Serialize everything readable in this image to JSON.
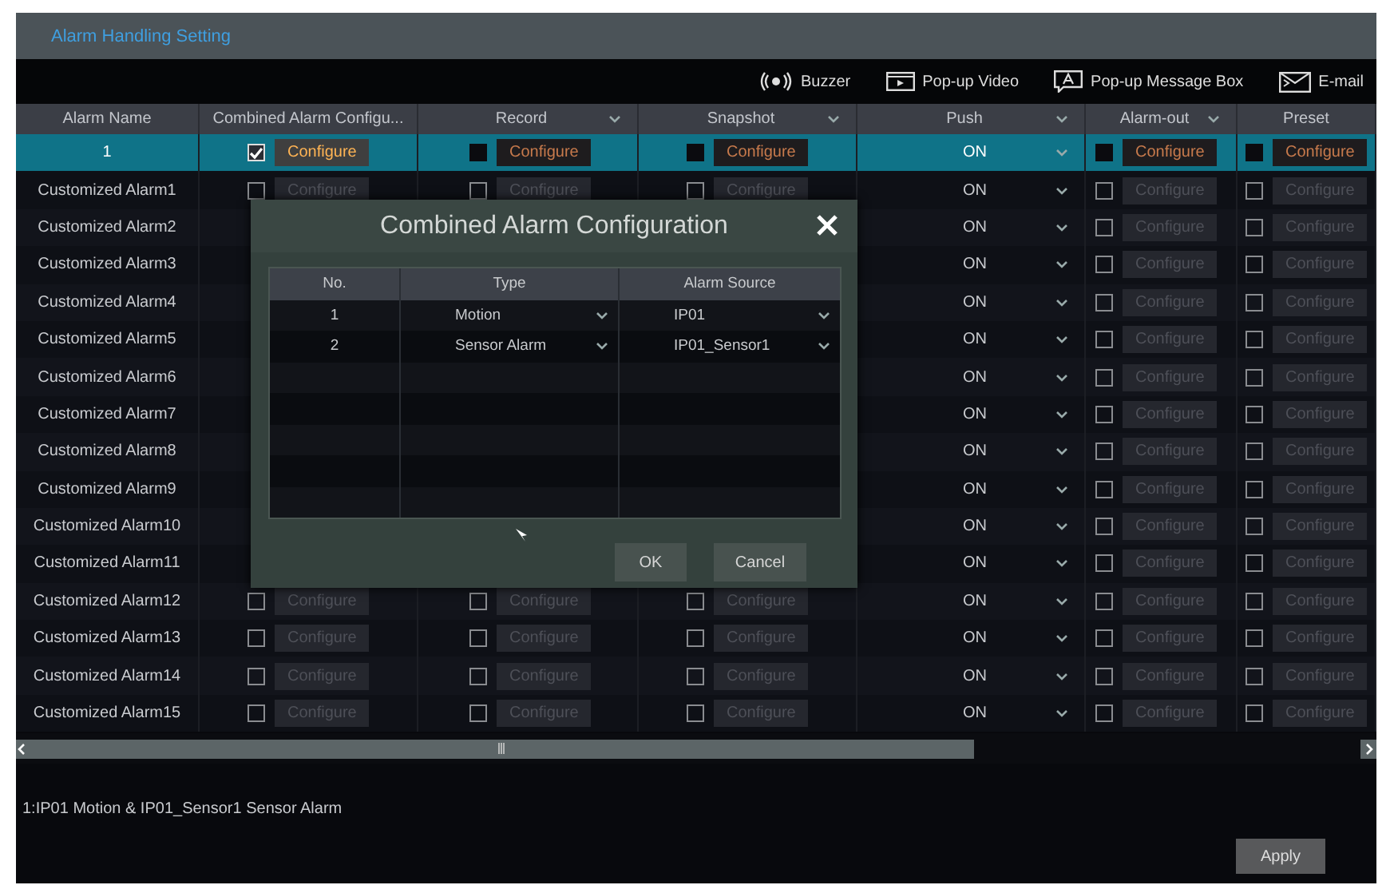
{
  "window": {
    "title": "Alarm Handling Setting"
  },
  "toolbar": [
    {
      "kind": "buzzer",
      "label": "Buzzer"
    },
    {
      "kind": "video",
      "label": "Pop-up Video"
    },
    {
      "kind": "message",
      "label": "Pop-up Message Box"
    },
    {
      "kind": "email",
      "label": "E-mail"
    }
  ],
  "table": {
    "columns": [
      {
        "label": "Alarm Name",
        "dropdown": false
      },
      {
        "label": "Combined Alarm Configu...",
        "dropdown": false
      },
      {
        "label": "Record",
        "dropdown": true
      },
      {
        "label": "Snapshot",
        "dropdown": true
      },
      {
        "label": "Push",
        "dropdown": true
      },
      {
        "label": "Alarm-out",
        "dropdown": true
      },
      {
        "label": "Preset",
        "dropdown": false
      }
    ],
    "rows": [
      {
        "name": "1",
        "selected": true,
        "combined": {
          "checked": true,
          "button": "Configure"
        },
        "record": {
          "checked": false,
          "button": "Configure"
        },
        "snapshot": {
          "checked": false,
          "button": "Configure"
        },
        "push": "ON",
        "alarm_out": {
          "checked": false,
          "button": "Configure"
        },
        "preset": {
          "checked": false,
          "button": "Configure"
        }
      },
      {
        "name": "Customized Alarm1",
        "selected": false,
        "combined": {
          "checked": false,
          "button": "Configure"
        },
        "record": {
          "checked": false,
          "button": "Configure"
        },
        "snapshot": {
          "checked": false,
          "button": "Configure"
        },
        "push": "ON",
        "alarm_out": {
          "checked": false,
          "button": "Configure"
        },
        "preset": {
          "checked": false,
          "button": "Configure"
        }
      },
      {
        "name": "Customized Alarm2",
        "selected": false,
        "push": "ON",
        "alarm_out": {
          "checked": false,
          "button": "Configure"
        },
        "preset": {
          "checked": false,
          "button": "Configure"
        }
      },
      {
        "name": "Customized Alarm3",
        "selected": false,
        "push": "ON",
        "alarm_out": {
          "checked": false,
          "button": "Configure"
        },
        "preset": {
          "checked": false,
          "button": "Configure"
        }
      },
      {
        "name": "Customized Alarm4",
        "selected": false,
        "push": "ON",
        "alarm_out": {
          "checked": false,
          "button": "Configure"
        },
        "preset": {
          "checked": false,
          "button": "Configure"
        }
      },
      {
        "name": "Customized Alarm5",
        "selected": false,
        "push": "ON",
        "alarm_out": {
          "checked": false,
          "button": "Configure"
        },
        "preset": {
          "checked": false,
          "button": "Configure"
        }
      },
      {
        "name": "Customized Alarm6",
        "selected": false,
        "push": "ON",
        "alarm_out": {
          "checked": false,
          "button": "Configure"
        },
        "preset": {
          "checked": false,
          "button": "Configure"
        }
      },
      {
        "name": "Customized Alarm7",
        "selected": false,
        "push": "ON",
        "alarm_out": {
          "checked": false,
          "button": "Configure"
        },
        "preset": {
          "checked": false,
          "button": "Configure"
        }
      },
      {
        "name": "Customized Alarm8",
        "selected": false,
        "push": "ON",
        "alarm_out": {
          "checked": false,
          "button": "Configure"
        },
        "preset": {
          "checked": false,
          "button": "Configure"
        }
      },
      {
        "name": "Customized Alarm9",
        "selected": false,
        "push": "ON",
        "alarm_out": {
          "checked": false,
          "button": "Configure"
        },
        "preset": {
          "checked": false,
          "button": "Configure"
        }
      },
      {
        "name": "Customized Alarm10",
        "selected": false,
        "push": "ON",
        "alarm_out": {
          "checked": false,
          "button": "Configure"
        },
        "preset": {
          "checked": false,
          "button": "Configure"
        }
      },
      {
        "name": "Customized Alarm11",
        "selected": false,
        "push": "ON",
        "alarm_out": {
          "checked": false,
          "button": "Configure"
        },
        "preset": {
          "checked": false,
          "button": "Configure"
        }
      },
      {
        "name": "Customized Alarm12",
        "selected": false,
        "combined": {
          "checked": false,
          "button": "Configure"
        },
        "record": {
          "checked": false,
          "button": "Configure"
        },
        "snapshot": {
          "checked": false,
          "button": "Configure"
        },
        "push": "ON",
        "alarm_out": {
          "checked": false,
          "button": "Configure"
        },
        "preset": {
          "checked": false,
          "button": "Configure"
        }
      },
      {
        "name": "Customized Alarm13",
        "selected": false,
        "combined": {
          "checked": false,
          "button": "Configure"
        },
        "record": {
          "checked": false,
          "button": "Configure"
        },
        "snapshot": {
          "checked": false,
          "button": "Configure"
        },
        "push": "ON",
        "alarm_out": {
          "checked": false,
          "button": "Configure"
        },
        "preset": {
          "checked": false,
          "button": "Configure"
        }
      },
      {
        "name": "Customized Alarm14",
        "selected": false,
        "combined": {
          "checked": false,
          "button": "Configure"
        },
        "record": {
          "checked": false,
          "button": "Configure"
        },
        "snapshot": {
          "checked": false,
          "button": "Configure"
        },
        "push": "ON",
        "alarm_out": {
          "checked": false,
          "button": "Configure"
        },
        "preset": {
          "checked": false,
          "button": "Configure"
        }
      },
      {
        "name": "Customized Alarm15",
        "selected": false,
        "combined": {
          "checked": false,
          "button": "Configure"
        },
        "record": {
          "checked": false,
          "button": "Configure"
        },
        "snapshot": {
          "checked": false,
          "button": "Configure"
        },
        "push": "ON",
        "alarm_out": {
          "checked": false,
          "button": "Configure"
        },
        "preset": {
          "checked": false,
          "button": "Configure"
        }
      }
    ]
  },
  "dialog": {
    "title": "Combined Alarm Configuration",
    "columns": [
      "No.",
      "Type",
      "Alarm Source"
    ],
    "rows": [
      {
        "no": "1",
        "type": "Motion",
        "source": "IP01"
      },
      {
        "no": "2",
        "type": "Sensor Alarm",
        "source": "IP01_Sensor1"
      }
    ],
    "buttons": [
      "OK",
      "Cancel"
    ]
  },
  "summary": "1:IP01 Motion & IP01_Sensor1 Sensor Alarm",
  "apply": "Apply"
}
